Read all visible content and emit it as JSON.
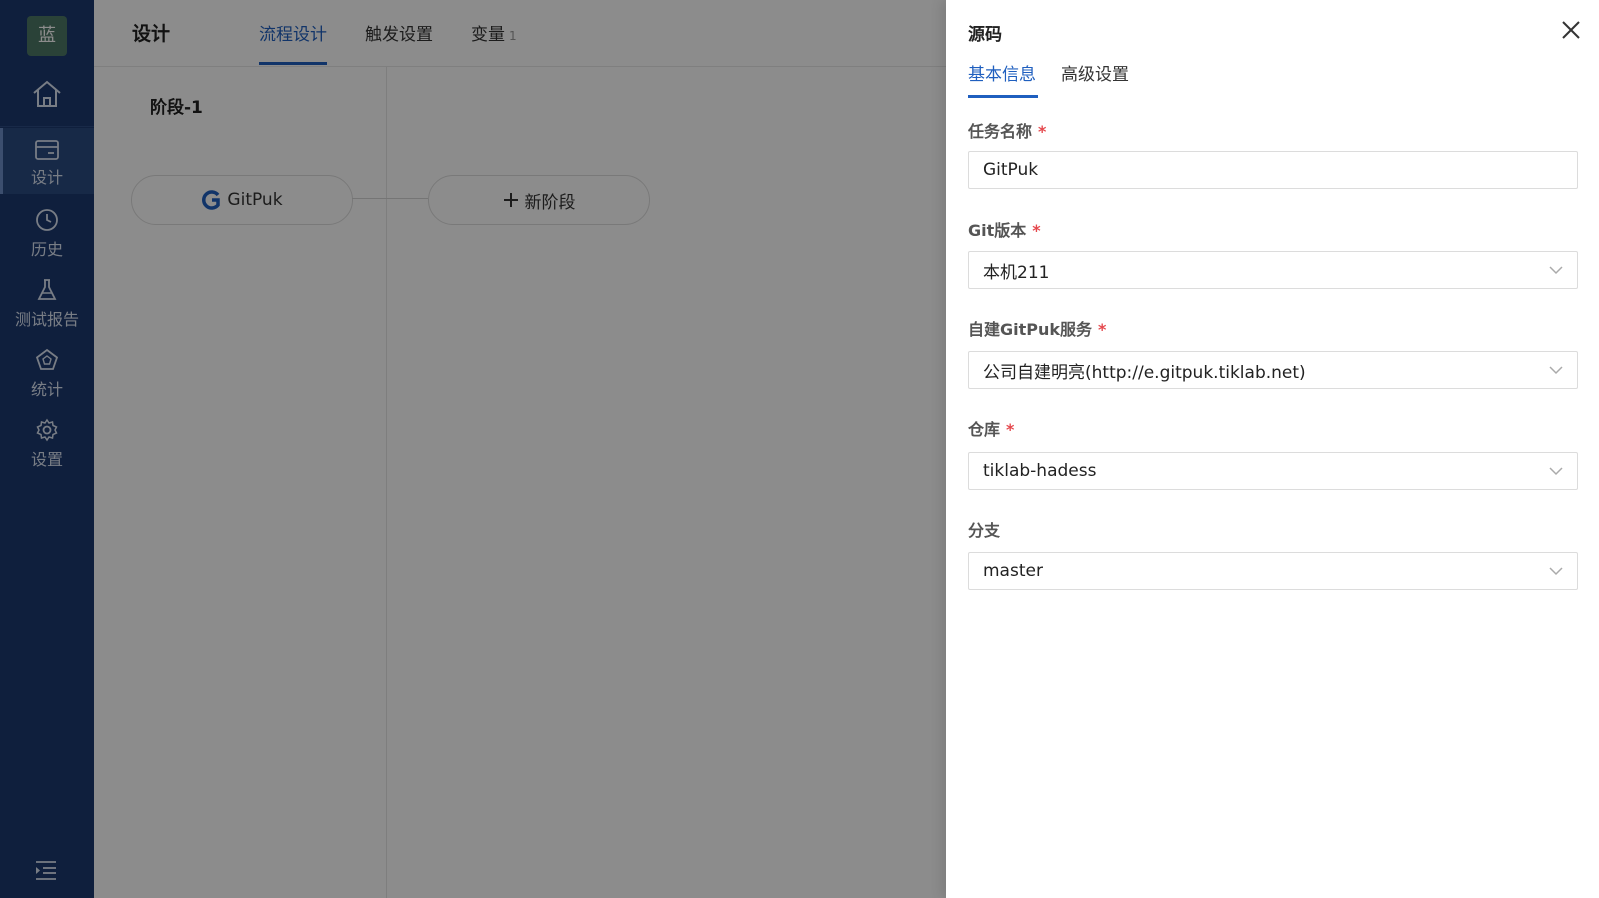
{
  "sidebar": {
    "avatar_text": "蓝",
    "items": [
      {
        "label": "设计",
        "icon": "design-icon"
      },
      {
        "label": "历史",
        "icon": "clock-icon"
      },
      {
        "label": "测试报告",
        "icon": "flask-icon"
      },
      {
        "label": "统计",
        "icon": "pentagon-chart-icon"
      },
      {
        "label": "设置",
        "icon": "gear-icon"
      }
    ]
  },
  "header": {
    "title": "设计",
    "tabs": [
      {
        "label": "流程设计"
      },
      {
        "label": "触发设置"
      },
      {
        "label": "变量",
        "badge": "1"
      }
    ]
  },
  "pipeline": {
    "stage_title": "阶段-1",
    "task_node": "GitPuk",
    "add_stage": "新阶段"
  },
  "drawer": {
    "title": "源码",
    "tabs": [
      {
        "label": "基本信息"
      },
      {
        "label": "高级设置"
      }
    ],
    "required_mark": "*",
    "fields": {
      "task_name": {
        "label": "任务名称",
        "value": "GitPuk"
      },
      "git_version": {
        "label": "Git版本",
        "value": "本机211"
      },
      "gitpuk_service": {
        "label": "自建GitPuk服务",
        "value": "公司自建明亮(http://e.gitpuk.tiklab.net)"
      },
      "repository": {
        "label": "仓库",
        "value": "tiklab-hadess"
      },
      "branch": {
        "label": "分支",
        "value": "master"
      }
    }
  },
  "colors": {
    "sidebar_bg": "#1d3a70",
    "accent": "#1f5fbf",
    "required": "#e5484d"
  }
}
